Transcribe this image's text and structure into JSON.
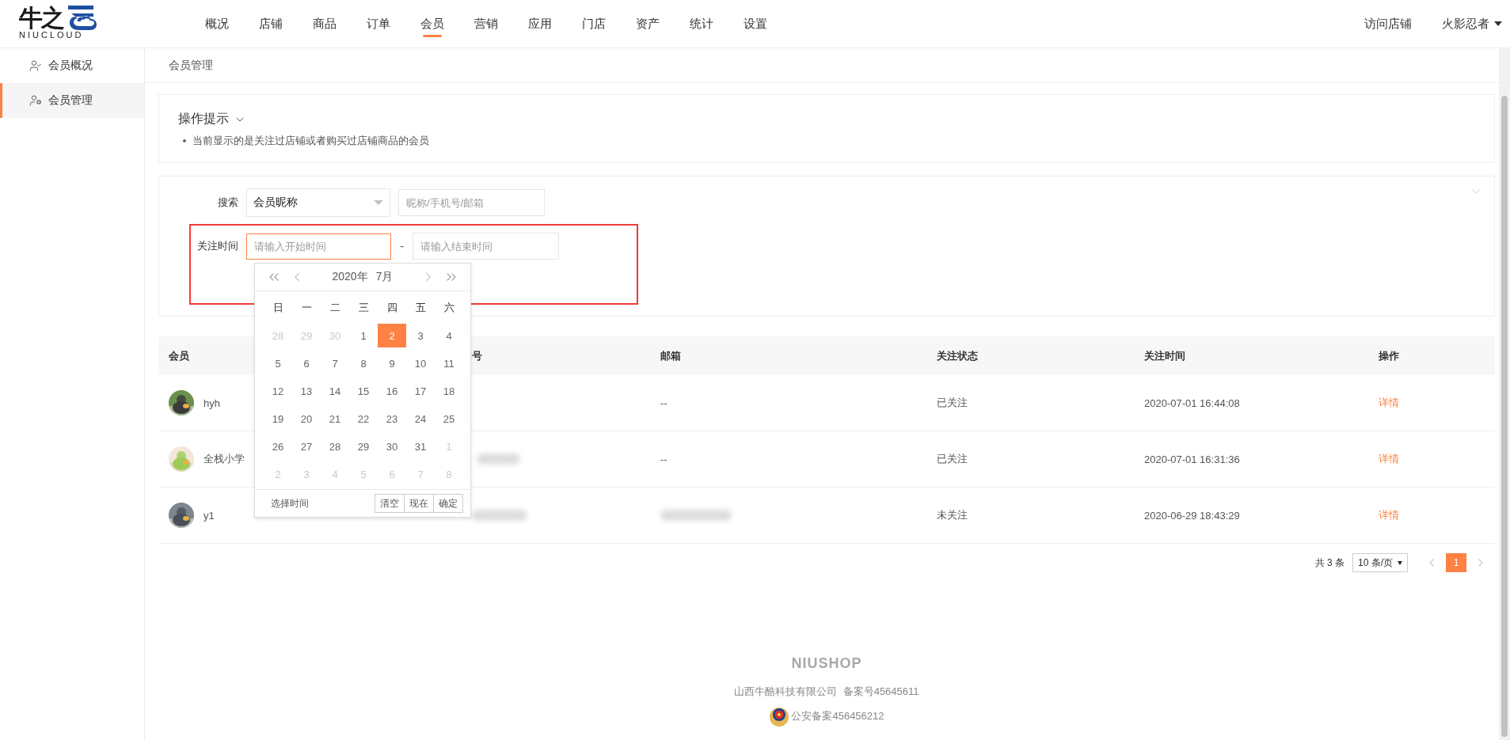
{
  "logo": {
    "mark": "牛之",
    "subtitle": "NIUCLOUD"
  },
  "nav": [
    {
      "label": "概况",
      "selected": false
    },
    {
      "label": "店铺",
      "selected": false
    },
    {
      "label": "商品",
      "selected": false
    },
    {
      "label": "订单",
      "selected": false
    },
    {
      "label": "会员",
      "selected": true
    },
    {
      "label": "营销",
      "selected": false
    },
    {
      "label": "应用",
      "selected": false
    },
    {
      "label": "门店",
      "selected": false
    },
    {
      "label": "资产",
      "selected": false
    },
    {
      "label": "统计",
      "selected": false
    },
    {
      "label": "设置",
      "selected": false
    }
  ],
  "header_right": {
    "visit_store": "访问店铺",
    "user": "火影忍者"
  },
  "sidebar": {
    "items": [
      {
        "label": "会员概况",
        "kind": "overview",
        "selected": false
      },
      {
        "label": "会员管理",
        "kind": "manage",
        "selected": true
      }
    ]
  },
  "breadcrumb": "会员管理",
  "tips": {
    "title": "操作提示",
    "items": [
      "当前显示的是关注过店铺或者购买过店铺商品的会员"
    ]
  },
  "search": {
    "label": "搜索",
    "select_value": "会员昵称",
    "placeholder": "昵称/手机号/邮箱"
  },
  "follow_time": {
    "label": "关注时间",
    "start_placeholder": "请输入开始时间",
    "separator": "-",
    "end_placeholder": "请输入结束时间"
  },
  "calendar": {
    "year": "2020年",
    "month": "7月",
    "weekdays": [
      "日",
      "一",
      "二",
      "三",
      "四",
      "五",
      "六"
    ],
    "days": [
      {
        "day": "28",
        "muted": true,
        "selected": false
      },
      {
        "day": "29",
        "muted": true,
        "selected": false
      },
      {
        "day": "30",
        "muted": true,
        "selected": false
      },
      {
        "day": "1",
        "muted": false,
        "selected": false
      },
      {
        "day": "2",
        "muted": false,
        "selected": true
      },
      {
        "day": "3",
        "muted": false,
        "selected": false
      },
      {
        "day": "4",
        "muted": false,
        "selected": false
      },
      {
        "day": "5",
        "muted": false,
        "selected": false
      },
      {
        "day": "6",
        "muted": false,
        "selected": false
      },
      {
        "day": "7",
        "muted": false,
        "selected": false
      },
      {
        "day": "8",
        "muted": false,
        "selected": false
      },
      {
        "day": "9",
        "muted": false,
        "selected": false
      },
      {
        "day": "10",
        "muted": false,
        "selected": false
      },
      {
        "day": "11",
        "muted": false,
        "selected": false
      },
      {
        "day": "12",
        "muted": false,
        "selected": false
      },
      {
        "day": "13",
        "muted": false,
        "selected": false
      },
      {
        "day": "14",
        "muted": false,
        "selected": false
      },
      {
        "day": "15",
        "muted": false,
        "selected": false
      },
      {
        "day": "16",
        "muted": false,
        "selected": false
      },
      {
        "day": "17",
        "muted": false,
        "selected": false
      },
      {
        "day": "18",
        "muted": false,
        "selected": false
      },
      {
        "day": "19",
        "muted": false,
        "selected": false
      },
      {
        "day": "20",
        "muted": false,
        "selected": false
      },
      {
        "day": "21",
        "muted": false,
        "selected": false
      },
      {
        "day": "22",
        "muted": false,
        "selected": false
      },
      {
        "day": "23",
        "muted": false,
        "selected": false
      },
      {
        "day": "24",
        "muted": false,
        "selected": false
      },
      {
        "day": "25",
        "muted": false,
        "selected": false
      },
      {
        "day": "26",
        "muted": false,
        "selected": false
      },
      {
        "day": "27",
        "muted": false,
        "selected": false
      },
      {
        "day": "28",
        "muted": false,
        "selected": false
      },
      {
        "day": "29",
        "muted": false,
        "selected": false
      },
      {
        "day": "30",
        "muted": false,
        "selected": false
      },
      {
        "day": "31",
        "muted": false,
        "selected": false
      },
      {
        "day": "1",
        "muted": true,
        "selected": false
      },
      {
        "day": "2",
        "muted": true,
        "selected": false
      },
      {
        "day": "3",
        "muted": true,
        "selected": false
      },
      {
        "day": "4",
        "muted": true,
        "selected": false
      },
      {
        "day": "5",
        "muted": true,
        "selected": false
      },
      {
        "day": "6",
        "muted": true,
        "selected": false
      },
      {
        "day": "7",
        "muted": true,
        "selected": false
      },
      {
        "day": "8",
        "muted": true,
        "selected": false
      }
    ],
    "footer_label": "选择时间",
    "buttons": [
      "清空",
      "现在",
      "确定"
    ]
  },
  "table": {
    "columns": [
      "会员",
      "号",
      "邮箱",
      "关注状态",
      "关注时间",
      "操作"
    ],
    "rows": [
      {
        "name": "hyh",
        "phone_hidden": false,
        "email": "--",
        "email_hidden": false,
        "status": "已关注",
        "time": "2020-07-01 16:44:08",
        "action": "详情"
      },
      {
        "name": "全栈小学",
        "phone_hidden": true,
        "email": "--",
        "email_hidden": false,
        "status": "已关注",
        "time": "2020-07-01 16:31:36",
        "action": "详情"
      },
      {
        "name": "y1",
        "phone_hidden": true,
        "email_hidden": true,
        "status": "未关注",
        "time": "2020-06-29 18:43:29",
        "action": "详情"
      }
    ]
  },
  "pagination": {
    "total": "共 3 条",
    "page_size": "10 条/页",
    "pages": [
      {
        "label": "1",
        "selected": true
      }
    ]
  },
  "footer": {
    "brand": "NIUSHOP",
    "company": "山西牛酷科技有限公司  备案号45645611",
    "police": "公安备案456456212"
  }
}
